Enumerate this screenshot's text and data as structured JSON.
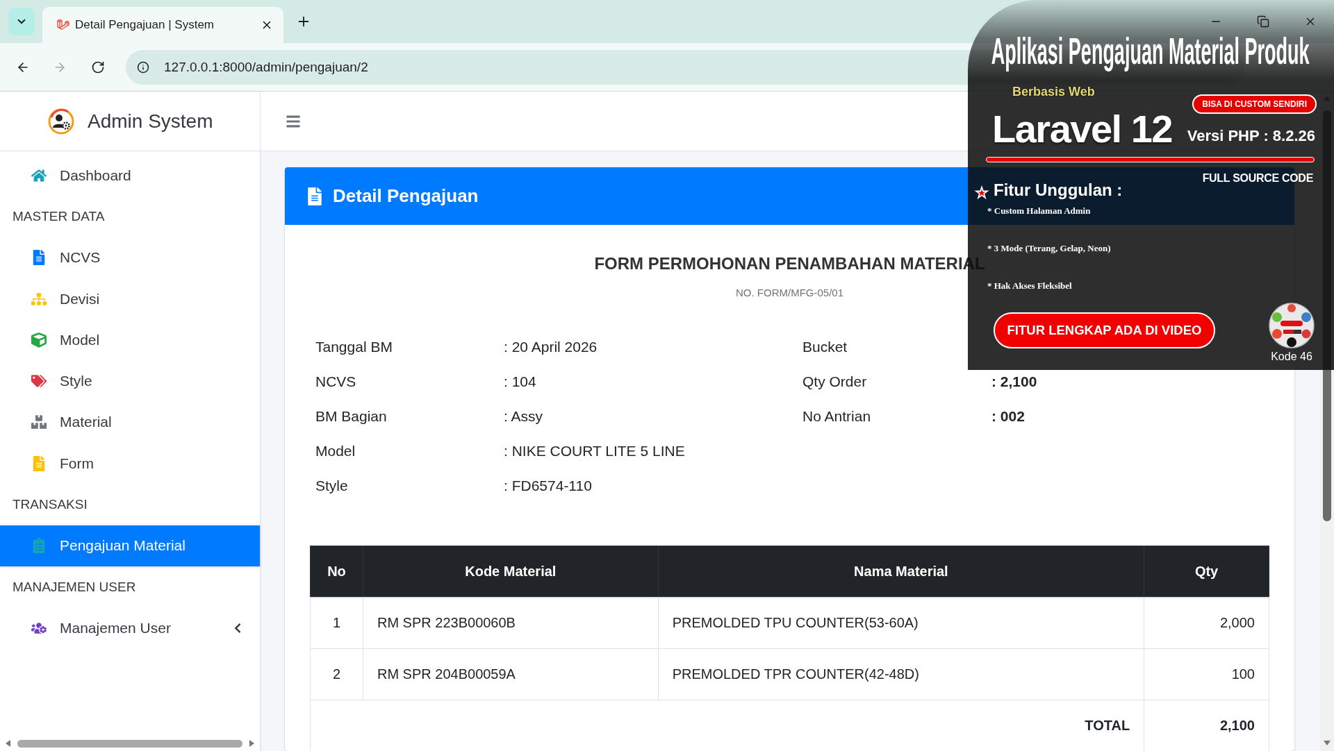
{
  "browser": {
    "tab_title": "Detail Pengajuan | System",
    "url": "127.0.0.1:8000/admin/pengajuan/2",
    "forward_disabled": true
  },
  "sidebar": {
    "brand": "Admin System",
    "sections": [
      {
        "items": [
          {
            "label": "Dashboard",
            "selected": false
          }
        ]
      },
      {
        "header": "MASTER DATA",
        "items": [
          {
            "label": "NCVS",
            "selected": false
          },
          {
            "label": "Devisi",
            "selected": false
          },
          {
            "label": "Model",
            "selected": false
          },
          {
            "label": "Style",
            "selected": false
          },
          {
            "label": "Material",
            "selected": false
          },
          {
            "label": "Form",
            "selected": false
          }
        ]
      },
      {
        "header": "TRANSAKSI",
        "items": [
          {
            "label": "Pengajuan Material",
            "selected": true
          }
        ]
      },
      {
        "header": "MANAJEMEN USER",
        "items": [
          {
            "label": "Manajemen User",
            "selected": false,
            "expanded": false
          }
        ]
      }
    ]
  },
  "card": {
    "title": "Detail Pengajuan",
    "form_title": "FORM PERMOHONAN PENAMBAHAN MATERIAL",
    "form_number": "NO. FORM/MFG-05/01",
    "fields_left": [
      {
        "label": "Tanggal BM",
        "value": ": 20 April 2026"
      },
      {
        "label": "NCVS",
        "value": ": 104"
      },
      {
        "label": "BM Bagian",
        "value": ": Assy"
      },
      {
        "label": "Model",
        "value": ": NIKE COURT LITE 5 LINE"
      },
      {
        "label": "Style",
        "value": ": FD6574-110"
      }
    ],
    "fields_right": [
      {
        "label": "Bucket"
      },
      {
        "label": "Qty Order",
        "value": ": 2,100",
        "bold": true
      },
      {
        "label": "No Antrian",
        "value": ": 002",
        "bold": true
      }
    ],
    "table": {
      "columns": [
        "No",
        "Kode Material",
        "Nama Material",
        "Qty"
      ],
      "rows": [
        [
          "1",
          "RM SPR 223B00060B",
          "PREMOLDED TPU COUNTER(53-60A)",
          "2,000"
        ],
        [
          "2",
          "RM SPR 204B00059A",
          "PREMOLDED TPR COUNTER(42-48D)",
          "100"
        ]
      ],
      "total_label": "TOTAL",
      "total_value": "2,100"
    }
  },
  "promo": {
    "title": "Aplikasi Pengajuan Material Produk",
    "subtitle": "Berbasis Web",
    "badge": "BISA DI CUSTOM SENDIRI",
    "framework": "Laravel 12",
    "php_version": "Versi PHP : 8.2.26",
    "source_note": "FULL SOURCE CODE",
    "features_title": "Fitur Unggulan :",
    "features": [
      "* Custom Halaman Admin",
      "* 3 Mode (Terang, Gelap, Neon)",
      "* Hak Akses Fleksibel"
    ],
    "cta": "FITUR LENGKAP ADA DI VIDEO",
    "code": "Kode 46"
  }
}
